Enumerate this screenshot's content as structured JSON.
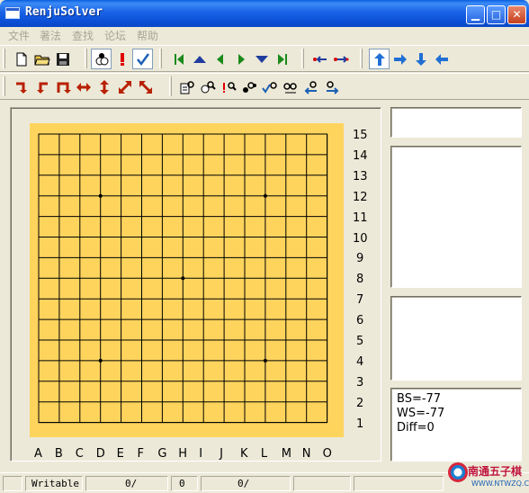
{
  "window": {
    "title": "RenjuSolver",
    "controls": [
      "minimize",
      "maximize",
      "close"
    ]
  },
  "menu": [
    "文件",
    "著法",
    "查找",
    "论坛",
    "帮助"
  ],
  "toolbar1": [
    {
      "name": "new-file-icon",
      "color": "#000000"
    },
    {
      "name": "open-folder-icon",
      "color": "#d4a017"
    },
    {
      "name": "save-disk-icon",
      "color": "#000000"
    },
    {
      "name": "stones-icon",
      "color": "#000000"
    },
    {
      "name": "exclamation-icon",
      "color": "#e00000"
    },
    {
      "name": "checkmark-icon",
      "color": "#1a5fb4"
    },
    {
      "name": "first-move-icon",
      "color": "#1a8a1a"
    },
    {
      "name": "up-arrow-icon",
      "color": "#1f3c9e"
    },
    {
      "name": "back-arrow-icon",
      "color": "#1a8a1a"
    },
    {
      "name": "forward-arrow-icon",
      "color": "#1a8a1a"
    },
    {
      "name": "down-arrow-icon",
      "color": "#1f3c9e"
    },
    {
      "name": "last-move-icon",
      "color": "#1a8a1a"
    },
    {
      "name": "move-left-icon",
      "color": "#d40000"
    },
    {
      "name": "move-right-icon",
      "color": "#d40000"
    },
    {
      "name": "nav-up-icon",
      "color": "#1f6fd4"
    },
    {
      "name": "nav-right-icon",
      "color": "#1f6fd4"
    },
    {
      "name": "nav-down-icon",
      "color": "#1f6fd4"
    },
    {
      "name": "nav-left-icon",
      "color": "#1f6fd4"
    }
  ],
  "toolbar2": [
    {
      "name": "rotate-down-icon",
      "color": "#b82000"
    },
    {
      "name": "rotate-left-icon",
      "color": "#b82000"
    },
    {
      "name": "rotate-up-icon",
      "color": "#b82000"
    },
    {
      "name": "flip-horizontal-icon",
      "color": "#b82000"
    },
    {
      "name": "flip-vertical-icon",
      "color": "#b82000"
    },
    {
      "name": "flip-diagonal-icon",
      "color": "#b82000"
    },
    {
      "name": "flip-antidiagonal-icon",
      "color": "#b82000"
    },
    {
      "name": "search-doc-icon",
      "color": "#000000"
    },
    {
      "name": "search-white-icon",
      "color": "#000000"
    },
    {
      "name": "search-excl-icon",
      "color": "#e00000"
    },
    {
      "name": "search-black-icon",
      "color": "#000000"
    },
    {
      "name": "search-check-icon",
      "color": "#1a5fb4"
    },
    {
      "name": "search-pair-icon",
      "color": "#000000"
    },
    {
      "name": "search-back-icon",
      "color": "#1a5fb4"
    },
    {
      "name": "search-forward-icon",
      "color": "#1a5fb4"
    }
  ],
  "board": {
    "size": 15,
    "background": "#fed45d",
    "line_color": "#000000",
    "star_points": [
      [
        "D",
        12
      ],
      [
        "L",
        12
      ],
      [
        "H",
        8
      ],
      [
        "D",
        4
      ],
      [
        "L",
        4
      ]
    ],
    "rank_labels": [
      "15",
      "14",
      "13",
      "12",
      "11",
      "10",
      "9",
      "8",
      "7",
      "6",
      "5",
      "4",
      "3",
      "2",
      "1"
    ],
    "file_labels": [
      "A",
      "B",
      "C",
      "D",
      "E",
      "F",
      "G",
      "H",
      "I",
      "J",
      "K",
      "L",
      "M",
      "N",
      "O"
    ]
  },
  "stats": {
    "bs": "BS=-77",
    "ws": "WS=-77",
    "diff": "Diff=0"
  },
  "statusbar": {
    "mode": "Writable",
    "count1": "0/",
    "count2": "0",
    "count3": "0/"
  },
  "watermark": {
    "text": "南通五子棋",
    "url": "WWW.NTWZQ.COM"
  }
}
